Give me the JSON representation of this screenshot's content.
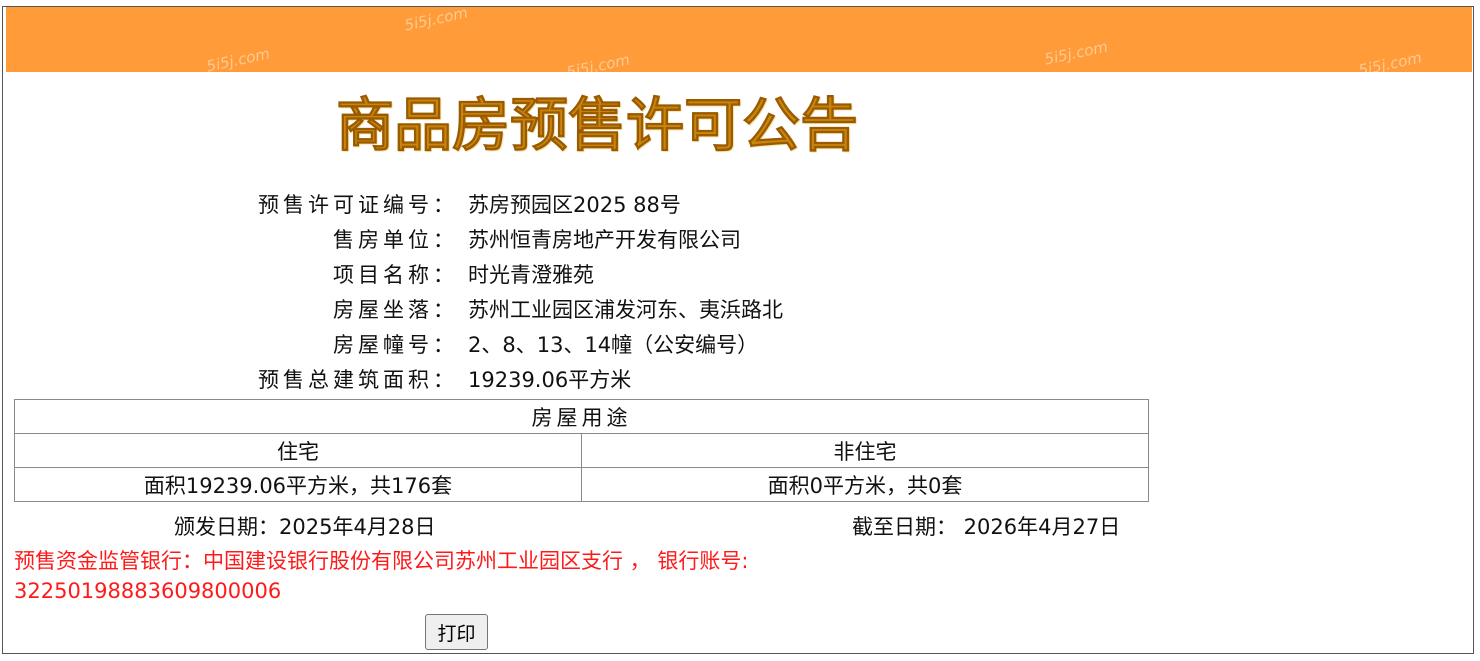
{
  "header": {
    "bar_color": "#ff9c39",
    "watermark_text": "5i5j.com"
  },
  "title": "商品房预售许可公告",
  "info": {
    "permit_no": {
      "label": "预售许可证编号：",
      "value": "苏房预园区2025 88号"
    },
    "seller": {
      "label": "售房单位：",
      "value": "苏州恒青房地产开发有限公司"
    },
    "project": {
      "label": "项目名称：",
      "value": "时光青澄雅苑"
    },
    "location": {
      "label": "房屋坐落：",
      "value": "苏州工业园区浦发河东、夷浜路北"
    },
    "buildings": {
      "label": "房屋幢号：",
      "value": "2、8、13、14幢（公安编号）"
    },
    "total_area": {
      "label": "预售总建筑面积：",
      "value": "19239.06平方米"
    }
  },
  "usage_table": {
    "heading": "房屋用途",
    "columns": [
      "住宅",
      "非住宅"
    ],
    "values": [
      "面积19239.06平方米，共176套",
      "面积0平方米，共0套"
    ]
  },
  "dates": {
    "issue": "颁发日期：2025年4月28日",
    "expire": "截至日期： 2026年4月27日"
  },
  "bank": {
    "text": "预售资金监管银行：中国建设银行股份有限公司苏州工业园区支行 ， 银行账号:",
    "account": "32250198883609800006",
    "color": "#ff1a1a"
  },
  "print_label": "打印"
}
